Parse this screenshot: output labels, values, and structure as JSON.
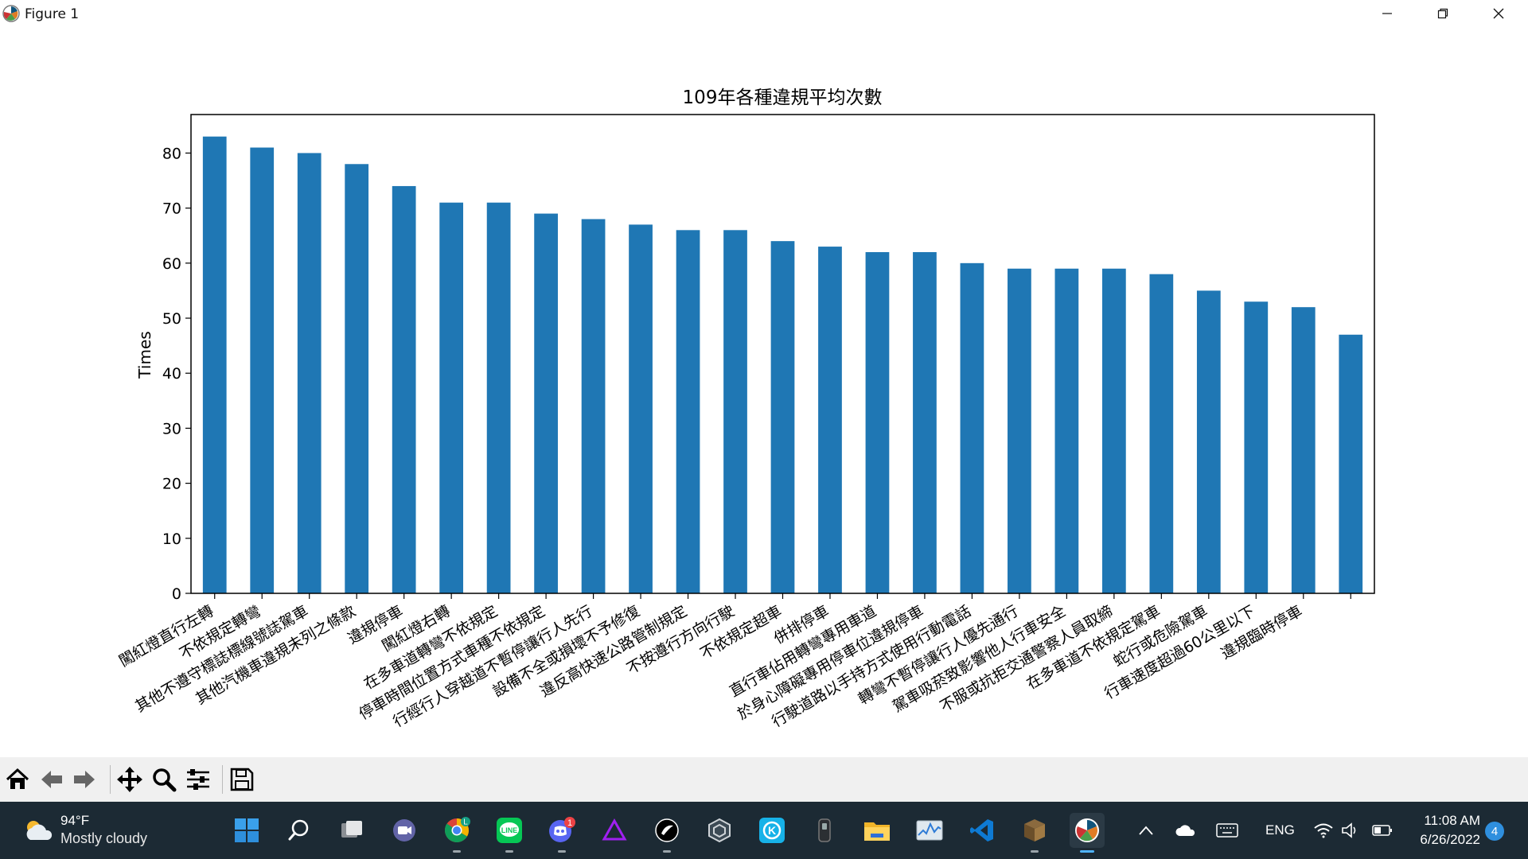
{
  "window": {
    "title": "Figure 1"
  },
  "chart_data": {
    "type": "bar",
    "title": "109年各種違規平均次數",
    "xlabel": "",
    "ylabel": "Times",
    "ylim": [
      0,
      87
    ],
    "yticks": [
      0,
      10,
      20,
      30,
      40,
      50,
      60,
      70,
      80
    ],
    "color": "#1f77b4",
    "grid": false,
    "legend": "none",
    "categories": [
      "闖紅燈直行左轉",
      "不依規定轉彎",
      "其他不遵守標誌標線號誌駕車",
      "其他汽機車違規未列之條款",
      "違規停車",
      "闖紅燈右轉",
      "在多車道轉彎不依規定",
      "停車時間位置方式車種不依規定",
      "行經行人穿越道不暫停讓行人先行",
      "設備不全或損壞不予修復",
      "違反高快速公路管制規定",
      "不按遵行方向行駛",
      "不依規定超車",
      "併排停車",
      "直行車佔用轉彎專用車道",
      "於身心障礙專用停車位違規停車",
      "行駛道路以手持方式使用行動電話",
      "轉彎不暫停讓行人優先通行",
      "駕車吸菸致影響他人行車安全",
      "不服或抗拒交通警察人員取締",
      "在多車道不依規定駕車",
      "蛇行或危險駕車",
      "行車速度超過60公里以下",
      "違規臨時停車"
    ],
    "values": [
      83,
      81,
      80,
      78,
      74,
      71,
      71,
      69,
      68,
      67,
      66,
      66,
      64,
      63,
      62,
      62,
      60,
      59,
      59,
      59,
      58,
      55,
      53,
      52,
      47
    ]
  },
  "toolbar": {
    "buttons": [
      "home-icon",
      "back-icon",
      "forward-icon",
      "pan-icon",
      "zoom-icon",
      "configure-subplots-icon",
      "save-icon"
    ]
  },
  "taskbar": {
    "weather": {
      "temp": "94°F",
      "desc": "Mostly cloudy"
    },
    "apps": [
      "windows-start-icon",
      "search-icon",
      "task-view-icon",
      "teams-chat-icon",
      "chrome-icon",
      "line-icon",
      "discord-icon",
      "affinity-icon",
      "inkscape-icon",
      "unity-icon",
      "kodi-icon",
      "obs-icon",
      "file-explorer-icon",
      "resource-monitor-icon",
      "vscode-icon",
      "minecraft-icon",
      "matplotlib-figure-icon"
    ],
    "chrome_badge": "L",
    "discord_badge": "1",
    "language": "ENG",
    "time": "11:08 AM",
    "date": "6/26/2022",
    "notifications": "4"
  }
}
